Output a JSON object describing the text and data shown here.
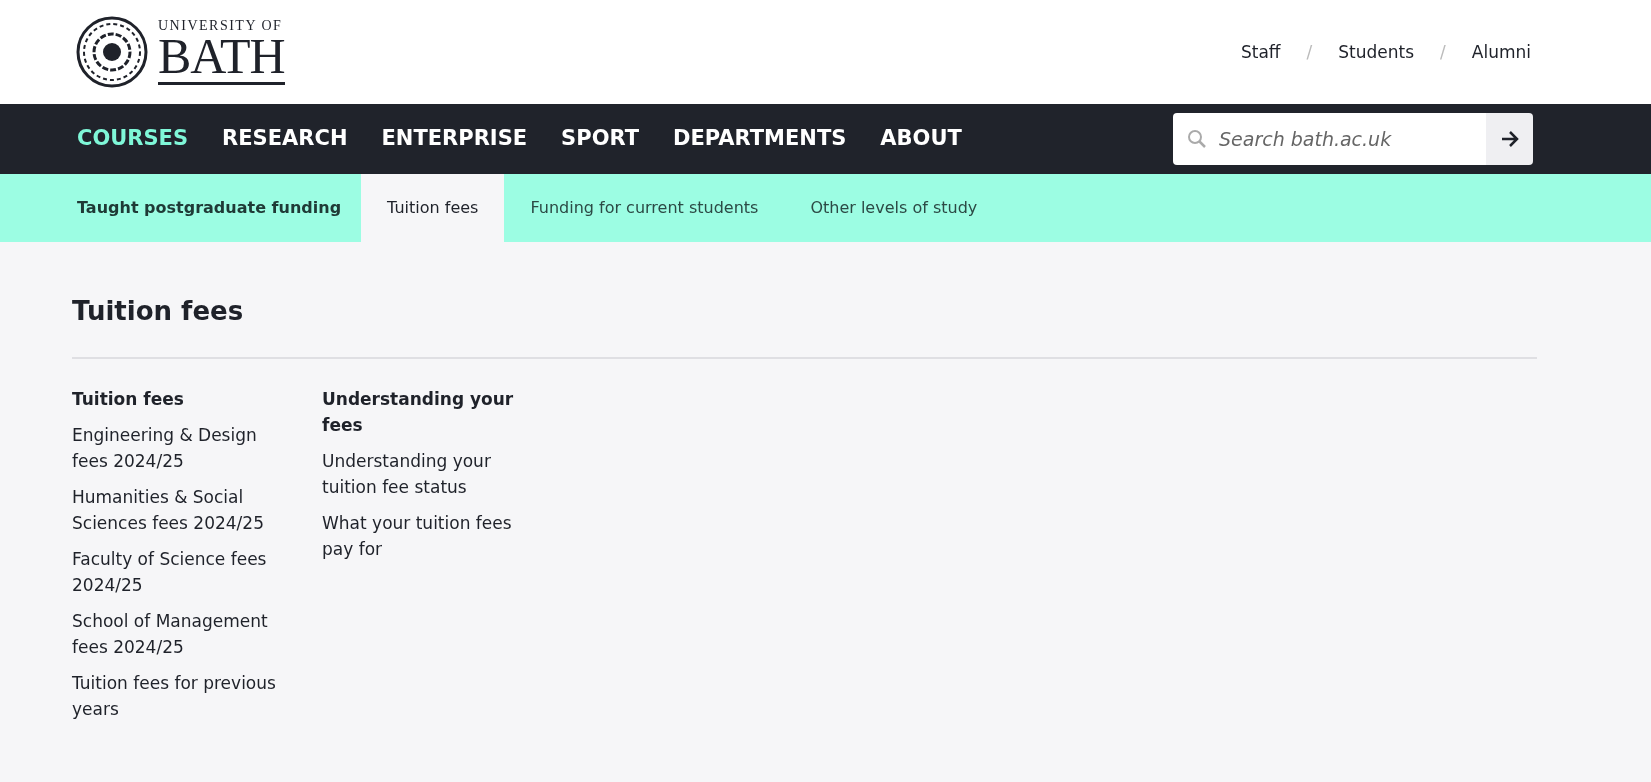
{
  "header": {
    "logo": {
      "line_1": "UNIVERSITY OF",
      "line_2": "BATH"
    },
    "audience_links": [
      {
        "label": "Staff"
      },
      {
        "label": "Students"
      },
      {
        "label": "Alumni"
      }
    ],
    "separator": "/"
  },
  "main_nav": {
    "items": [
      {
        "label": "COURSES",
        "selected": true
      },
      {
        "label": "RESEARCH",
        "selected": false
      },
      {
        "label": "ENTERPRISE",
        "selected": false
      },
      {
        "label": "SPORT",
        "selected": false
      },
      {
        "label": "DEPARTMENTS",
        "selected": false
      },
      {
        "label": "ABOUT",
        "selected": false
      }
    ],
    "search": {
      "placeholder": "Search bath.ac.uk"
    }
  },
  "sub_nav": {
    "title": "Taught postgraduate funding",
    "tabs": [
      {
        "label": "Tuition fees",
        "selected": true
      },
      {
        "label": "Funding for current students",
        "selected": false
      },
      {
        "label": "Other levels of study",
        "selected": false
      }
    ]
  },
  "page": {
    "heading": "Tuition fees",
    "columns": [
      {
        "heading": "Tuition fees",
        "links": [
          "Engineering & Design fees 2024/25",
          "Humanities & Social Sciences fees 2024/25",
          "Faculty of Science fees 2024/25",
          "School of Management fees 2024/25",
          "Tuition fees for previous years"
        ]
      },
      {
        "heading": "Understanding your fees",
        "links": [
          "Understanding your tuition fee status",
          "What your tuition fees pay for"
        ]
      }
    ]
  }
}
